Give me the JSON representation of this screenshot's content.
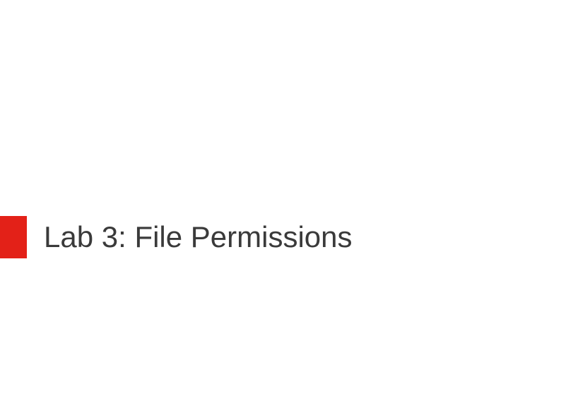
{
  "slide": {
    "title": "Lab 3: File Permissions",
    "accent_color": "#e32118",
    "text_color": "#3a3a3a"
  }
}
